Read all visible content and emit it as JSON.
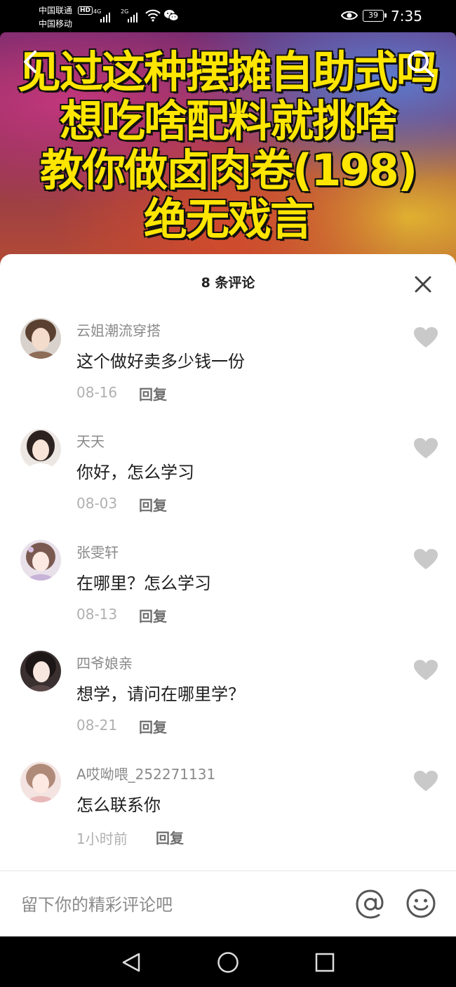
{
  "status_bar": {
    "carrier1": "中国联通",
    "carrier2": "中国移动",
    "hd_badge": "HD",
    "network1": "4G",
    "network2": "2G",
    "battery": "39",
    "time": "7:35"
  },
  "video": {
    "title_lines": [
      "见过这种摆摊自助式吗",
      "想吃啥配料就挑啥",
      "教你做卤肉卷(198)",
      "绝无戏言"
    ],
    "title_color": "#ffe600"
  },
  "comments_panel": {
    "title": "8 条评论",
    "comments": [
      {
        "username": "云姐潮流穿搭",
        "text": "这个做好卖多少钱一份",
        "date": "08-16",
        "reply_label": "回复"
      },
      {
        "username": "天天",
        "text": "你好，怎么学习",
        "date": "08-03",
        "reply_label": "回复"
      },
      {
        "username": "张雯轩",
        "text": "在哪里？怎么学习",
        "date": "08-13",
        "reply_label": "回复"
      },
      {
        "username": "四爷娘亲",
        "text": "想学，请问在哪里学？",
        "date": "08-21",
        "reply_label": "回复"
      },
      {
        "username": "A哎呦喂_252271131",
        "text": "怎么联系你",
        "date": "1小时前",
        "reply_label": "回复"
      }
    ]
  },
  "input_bar": {
    "placeholder": "留下你的精彩评论吧"
  },
  "colors": {
    "username": "#8a8a8a",
    "comment_text": "#1d1d1d",
    "date": "#b0b0b0",
    "heart": "#c9c9c9"
  }
}
